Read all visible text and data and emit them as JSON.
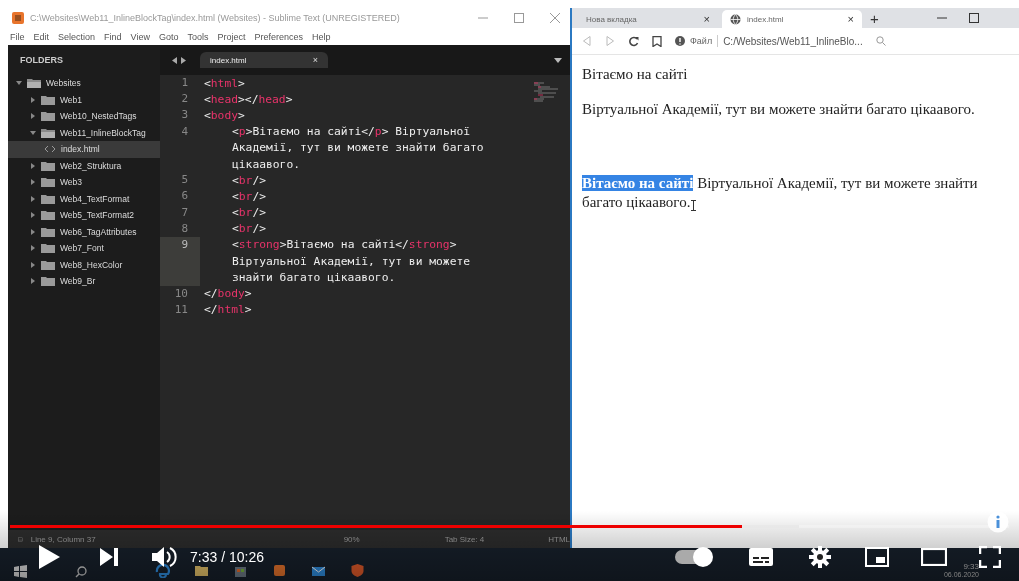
{
  "editor": {
    "title": "C:\\Websites\\Web11_InlineBlockTag\\index.html (Websites) - Sublime Text (UNREGISTERED)",
    "menu": [
      "File",
      "Edit",
      "Selection",
      "Find",
      "View",
      "Goto",
      "Tools",
      "Project",
      "Preferences",
      "Help"
    ],
    "sidebar": {
      "heading": "FOLDERS",
      "items": [
        {
          "label": "Websites",
          "kind": "folder",
          "expanded": true,
          "selected": false,
          "children": [
            {
              "label": "Web1",
              "kind": "folder",
              "expanded": false,
              "selected": false
            },
            {
              "label": "Web10_NestedTags",
              "kind": "folder",
              "expanded": false,
              "selected": false
            },
            {
              "label": "Web11_InlineBlockTag",
              "kind": "folder",
              "expanded": true,
              "selected": false,
              "children": [
                {
                  "label": "index.html",
                  "kind": "file",
                  "selected": true
                }
              ]
            },
            {
              "label": "Web2_Struktura",
              "kind": "folder",
              "expanded": false,
              "selected": false
            },
            {
              "label": "Web3",
              "kind": "folder",
              "expanded": false,
              "selected": false
            },
            {
              "label": "Web4_TextFormat",
              "kind": "folder",
              "expanded": false,
              "selected": false
            },
            {
              "label": "Web5_TextFormat2",
              "kind": "folder",
              "expanded": false,
              "selected": false
            },
            {
              "label": "Web6_TagAttributes",
              "kind": "folder",
              "expanded": false,
              "selected": false
            },
            {
              "label": "Web7_Font",
              "kind": "folder",
              "expanded": false,
              "selected": false
            },
            {
              "label": "Web8_HexColor",
              "kind": "folder",
              "expanded": false,
              "selected": false
            },
            {
              "label": "Web9_Br",
              "kind": "folder",
              "expanded": false,
              "selected": false
            }
          ]
        }
      ]
    },
    "tabs": [
      {
        "label": "index.html",
        "close": "×"
      }
    ],
    "lines": [
      {
        "number": "1",
        "current": false,
        "rows": [
          {
            "indented": false,
            "tokens": [
              {
                "kind": "punct",
                "text": "<"
              },
              {
                "kind": "tag",
                "text": "html"
              },
              {
                "kind": "punct",
                "text": ">"
              }
            ]
          }
        ]
      },
      {
        "number": "2",
        "current": false,
        "rows": [
          {
            "indented": false,
            "tokens": [
              {
                "kind": "punct",
                "text": "<"
              },
              {
                "kind": "tag",
                "text": "head"
              },
              {
                "kind": "punct",
                "text": "></"
              },
              {
                "kind": "tag",
                "text": "head"
              },
              {
                "kind": "punct",
                "text": ">"
              }
            ]
          }
        ]
      },
      {
        "number": "3",
        "current": false,
        "rows": [
          {
            "indented": false,
            "tokens": [
              {
                "kind": "punct",
                "text": "<"
              },
              {
                "kind": "tag",
                "text": "body"
              },
              {
                "kind": "punct",
                "text": ">"
              }
            ]
          }
        ]
      },
      {
        "number": "4",
        "current": false,
        "rows": [
          {
            "indented": true,
            "tokens": [
              {
                "kind": "punct",
                "text": "<"
              },
              {
                "kind": "tag",
                "text": "p"
              },
              {
                "kind": "punct",
                "text": ">Вітаємо на сайті</"
              },
              {
                "kind": "tag",
                "text": "p"
              },
              {
                "kind": "punct",
                "text": "> Віртуальної"
              }
            ]
          },
          {
            "indented": true,
            "tokens": [
              {
                "kind": "punct",
                "text": "Академії, тут ви можете знайти багато"
              }
            ]
          },
          {
            "indented": true,
            "tokens": [
              {
                "kind": "punct",
                "text": "цікаавого."
              }
            ]
          }
        ]
      },
      {
        "number": "5",
        "current": false,
        "rows": [
          {
            "indented": true,
            "tokens": [
              {
                "kind": "punct",
                "text": "<"
              },
              {
                "kind": "tag",
                "text": "br"
              },
              {
                "kind": "punct",
                "text": "/>"
              }
            ]
          }
        ]
      },
      {
        "number": "6",
        "current": false,
        "rows": [
          {
            "indented": true,
            "tokens": [
              {
                "kind": "punct",
                "text": "<"
              },
              {
                "kind": "tag",
                "text": "br"
              },
              {
                "kind": "punct",
                "text": "/>"
              }
            ]
          }
        ]
      },
      {
        "number": "7",
        "current": false,
        "rows": [
          {
            "indented": true,
            "tokens": [
              {
                "kind": "punct",
                "text": "<"
              },
              {
                "kind": "tag",
                "text": "br"
              },
              {
                "kind": "punct",
                "text": "/>"
              }
            ]
          }
        ]
      },
      {
        "number": "8",
        "current": false,
        "rows": [
          {
            "indented": true,
            "tokens": [
              {
                "kind": "punct",
                "text": "<"
              },
              {
                "kind": "tag",
                "text": "br"
              },
              {
                "kind": "punct",
                "text": "/>"
              }
            ]
          }
        ]
      },
      {
        "number": "9",
        "current": true,
        "rows": [
          {
            "indented": true,
            "tokens": [
              {
                "kind": "punct",
                "text": "<"
              },
              {
                "kind": "tag",
                "text": "strong"
              },
              {
                "kind": "punct",
                "text": ">Вітаємо на сайті</"
              },
              {
                "kind": "tag",
                "text": "strong"
              },
              {
                "kind": "punct",
                "text": ">"
              }
            ]
          },
          {
            "indented": true,
            "tokens": [
              {
                "kind": "punct",
                "text": "Віртуальної Академії, тут ви можете"
              }
            ]
          },
          {
            "indented": true,
            "tokens": [
              {
                "kind": "punct",
                "text": "знайти багато цікаавого."
              }
            ]
          }
        ]
      },
      {
        "number": "10",
        "current": false,
        "rows": [
          {
            "indented": false,
            "tokens": [
              {
                "kind": "punct",
                "text": "</"
              },
              {
                "kind": "tag",
                "text": "body"
              },
              {
                "kind": "punct",
                "text": ">"
              }
            ]
          }
        ]
      },
      {
        "number": "11",
        "current": false,
        "rows": [
          {
            "indented": false,
            "tokens": [
              {
                "kind": "punct",
                "text": "</"
              },
              {
                "kind": "tag",
                "text": "html"
              },
              {
                "kind": "punct",
                "text": ">"
              }
            ]
          }
        ]
      }
    ],
    "status_bar": {
      "position": "Line 9, Column 37",
      "zoom": "90%",
      "tab_size": "Tab Size: 4",
      "syntax": "HTML"
    }
  },
  "browser": {
    "tabs": [
      {
        "label": "Нова вкладка",
        "kind": "blank",
        "selected": false,
        "close": "×"
      },
      {
        "label": "index.html",
        "kind": "page",
        "selected": true,
        "close": "×"
      }
    ],
    "new_tab": "+",
    "address": {
      "scheme_label": "Файл",
      "url": "C:/Websites/Web11_InlineBlo..."
    },
    "content": [
      {
        "parts": [
          {
            "text": "Вітаємо на сайті",
            "bold": false,
            "selected": false
          }
        ]
      },
      {
        "parts": [
          {
            "text": "Віртуальної Академії, тут ви можете знайти багато цікаавого.",
            "bold": false,
            "selected": false
          }
        ]
      },
      {
        "parts": [
          {
            "text": "Вітаємо на сайті",
            "bold": true,
            "selected": true
          },
          {
            "text": " Віртуальної Академії, тут ви можете знайти багато цікаавого.",
            "bold": false,
            "selected": false
          }
        ]
      }
    ]
  },
  "taskbar": {
    "time": "9:33",
    "date": "06.06.2020"
  },
  "player": {
    "progress": {
      "level": 0.733
    },
    "buffer": {
      "level": 0.79
    },
    "time": "7:33 / 10:26",
    "autoplay": {
      "on": true
    }
  }
}
